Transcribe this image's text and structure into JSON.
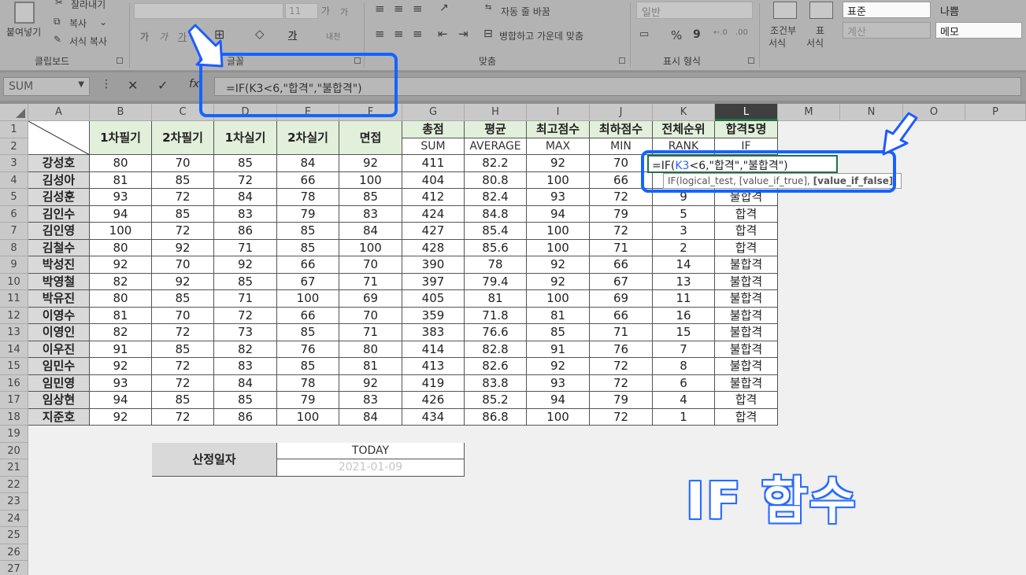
{
  "ribbon": {
    "clipboard": {
      "paste": "붙여넣기",
      "cut": "잘라내기",
      "copy": "복사",
      "format_painter": "서식 복사",
      "group": "클립보드"
    },
    "font": {
      "size": "11",
      "grow": "가",
      "shrink": "가",
      "bold": "가",
      "italic": "가",
      "underline": "가",
      "color_font": "가",
      "phonetic": "내천",
      "group": "글꼴"
    },
    "align": {
      "wrap": "자동 줄 바꿈",
      "merge": "병합하고 가운데 맞춤",
      "group": "맞춤"
    },
    "number": {
      "format": "일반",
      "percent": "%",
      "comma": "9",
      "group": "표시 형식"
    },
    "styles": {
      "conditional": "조건부",
      "conditional2": "서식",
      "table": "표",
      "table2": "서식",
      "normal": "표준",
      "bad": "나쁨",
      "calc": "계산",
      "memo": "메모"
    }
  },
  "formula_bar": {
    "name_box": "SUM",
    "cancel": "✕",
    "enter": "✓",
    "fx": "fx",
    "formula": "=IF(K3<6,\"합격\",\"불합격\")"
  },
  "columns": [
    "A",
    "B",
    "C",
    "D",
    "E",
    "F",
    "G",
    "H",
    "I",
    "J",
    "K",
    "L",
    "M",
    "N",
    "O",
    "P"
  ],
  "rows": [
    "1",
    "2",
    "3",
    "4",
    "5",
    "6",
    "7",
    "8",
    "9",
    "10",
    "11",
    "12",
    "13",
    "14",
    "15",
    "16",
    "17",
    "18",
    "19",
    "20",
    "21",
    "22",
    "23",
    "24",
    "25",
    "26",
    "27"
  ],
  "table": {
    "headers": [
      "1차필기",
      "2차필기",
      "1차실기",
      "2차실기",
      "면접",
      "총점",
      "평균",
      "최고점수",
      "최하점수",
      "전체순위",
      "합격5명"
    ],
    "subheaders": [
      "SUM",
      "AVERAGE",
      "MAX",
      "MIN",
      "RANK",
      "IF"
    ],
    "data": [
      [
        "강성호",
        "80",
        "70",
        "85",
        "84",
        "92",
        "411",
        "82.2",
        "92",
        "70",
        "",
        ""
      ],
      [
        "김성아",
        "81",
        "85",
        "72",
        "66",
        "100",
        "404",
        "80.8",
        "100",
        "66",
        "",
        ""
      ],
      [
        "김성훈",
        "93",
        "72",
        "84",
        "78",
        "85",
        "412",
        "82.4",
        "93",
        "72",
        "9",
        "불합격"
      ],
      [
        "김인수",
        "94",
        "85",
        "83",
        "79",
        "83",
        "424",
        "84.8",
        "94",
        "79",
        "5",
        "합격"
      ],
      [
        "김인영",
        "100",
        "72",
        "86",
        "85",
        "84",
        "427",
        "85.4",
        "100",
        "72",
        "3",
        "합격"
      ],
      [
        "김철수",
        "80",
        "92",
        "71",
        "85",
        "100",
        "428",
        "85.6",
        "100",
        "71",
        "2",
        "합격"
      ],
      [
        "박성진",
        "92",
        "70",
        "92",
        "66",
        "70",
        "390",
        "78",
        "92",
        "66",
        "14",
        "불합격"
      ],
      [
        "박영철",
        "82",
        "92",
        "85",
        "67",
        "71",
        "397",
        "79.4",
        "92",
        "67",
        "13",
        "불합격"
      ],
      [
        "박유진",
        "80",
        "85",
        "71",
        "100",
        "69",
        "405",
        "81",
        "100",
        "69",
        "11",
        "불합격"
      ],
      [
        "이영수",
        "81",
        "70",
        "72",
        "66",
        "70",
        "359",
        "71.8",
        "81",
        "66",
        "16",
        "불합격"
      ],
      [
        "이영인",
        "82",
        "72",
        "73",
        "85",
        "71",
        "383",
        "76.6",
        "85",
        "71",
        "15",
        "불합격"
      ],
      [
        "이우진",
        "91",
        "85",
        "82",
        "76",
        "80",
        "414",
        "82.8",
        "91",
        "76",
        "7",
        "불합격"
      ],
      [
        "임민수",
        "92",
        "72",
        "83",
        "85",
        "81",
        "413",
        "82.6",
        "92",
        "72",
        "8",
        "불합격"
      ],
      [
        "임민영",
        "93",
        "72",
        "84",
        "78",
        "92",
        "419",
        "83.8",
        "93",
        "72",
        "6",
        "불합격"
      ],
      [
        "임상현",
        "94",
        "85",
        "85",
        "79",
        "83",
        "426",
        "85.2",
        "94",
        "79",
        "4",
        "합격"
      ],
      [
        "지준호",
        "92",
        "72",
        "86",
        "100",
        "84",
        "434",
        "86.8",
        "100",
        "72",
        "1",
        "합격"
      ]
    ]
  },
  "date_block": {
    "label": "산정일자",
    "func": "TODAY",
    "value": "2021-01-09"
  },
  "edit": {
    "prefix": "=IF(",
    "ref": "K3",
    "rest": "<6,\"합격\",\"불합격\")",
    "tooltip_a": "IF(logical_test, [value_if_true], ",
    "tooltip_b": "[value_if_false]",
    "tooltip_c": ")"
  },
  "overlay_title": "IF 함수"
}
